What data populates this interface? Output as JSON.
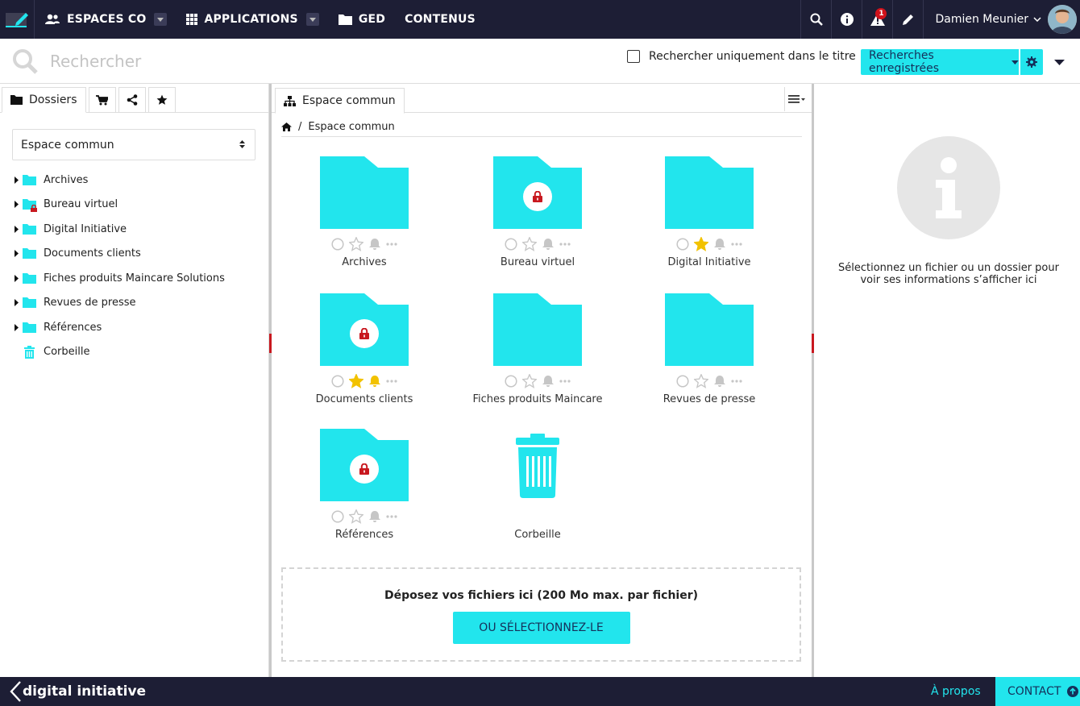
{
  "topbar": {
    "nav": [
      {
        "label": "ESPACES CO",
        "icon": "users-icon",
        "has_caret": true
      },
      {
        "label": "APPLICATIONS",
        "icon": "grid-icon",
        "has_caret": true
      },
      {
        "label": "GED",
        "icon": "folder-icon",
        "has_caret": false
      },
      {
        "label": "CONTENUS",
        "icon": "",
        "has_caret": false
      }
    ],
    "notification_count": "1",
    "user_name": "Damien Meunier"
  },
  "search": {
    "placeholder": "Rechercher",
    "title_only_label": "Rechercher uniquement dans le titre",
    "saved_searches_label": "Recherches enregistrées"
  },
  "left_panel": {
    "tab_folders_label": "Dossiers",
    "space_select_value": "Espace commun",
    "tree": [
      {
        "label": "Archives",
        "expandable": true,
        "locked": false,
        "icon": "folder-icon"
      },
      {
        "label": "Bureau virtuel",
        "expandable": true,
        "locked": true,
        "icon": "folder-icon"
      },
      {
        "label": "Digital Initiative",
        "expandable": true,
        "locked": false,
        "icon": "folder-icon"
      },
      {
        "label": "Documents clients",
        "expandable": true,
        "locked": false,
        "icon": "folder-icon"
      },
      {
        "label": "Fiches produits Maincare Solutions",
        "expandable": true,
        "locked": false,
        "icon": "folder-icon"
      },
      {
        "label": "Revues de presse",
        "expandable": true,
        "locked": false,
        "icon": "folder-icon"
      },
      {
        "label": "Références",
        "expandable": true,
        "locked": false,
        "icon": "folder-icon"
      },
      {
        "label": "Corbeille",
        "expandable": false,
        "locked": false,
        "icon": "trash-icon"
      }
    ]
  },
  "middle_panel": {
    "tab_label": "Espace commun",
    "breadcrumb_current": "Espace commun",
    "items": [
      {
        "name": "Archives",
        "type": "folder",
        "locked": false,
        "starred": false,
        "notified": false
      },
      {
        "name": "Bureau virtuel",
        "type": "folder",
        "locked": true,
        "starred": false,
        "notified": false
      },
      {
        "name": "Digital Initiative",
        "type": "folder",
        "locked": false,
        "starred": true,
        "notified": false
      },
      {
        "name": "Documents clients",
        "type": "folder",
        "locked": true,
        "starred": true,
        "notified": true
      },
      {
        "name": "Fiches produits Maincare",
        "type": "folder",
        "locked": false,
        "starred": false,
        "notified": false
      },
      {
        "name": "Revues de presse",
        "type": "folder",
        "locked": false,
        "starred": false,
        "notified": false
      },
      {
        "name": "Références",
        "type": "folder",
        "locked": true,
        "starred": false,
        "notified": false
      },
      {
        "name": "Corbeille",
        "type": "trash",
        "locked": false,
        "starred": false,
        "notified": false
      }
    ],
    "dropzone_text": "Déposez vos fichiers ici (200 Mo max. par fichier)",
    "dropzone_button": "OU SÉLECTIONNEZ-LE"
  },
  "right_panel": {
    "info_text": "Sélectionnez un fichier ou un dossier pour voir ses informations s’afficher ici"
  },
  "footer": {
    "logo_text": "digital initiative",
    "about_label": "À propos",
    "contact_label": "CONTACT"
  },
  "colors": {
    "accent": "#22e5ed",
    "nav_bg": "#1d1e35",
    "lock_red": "#c8181f",
    "star_yellow": "#f2c200"
  }
}
